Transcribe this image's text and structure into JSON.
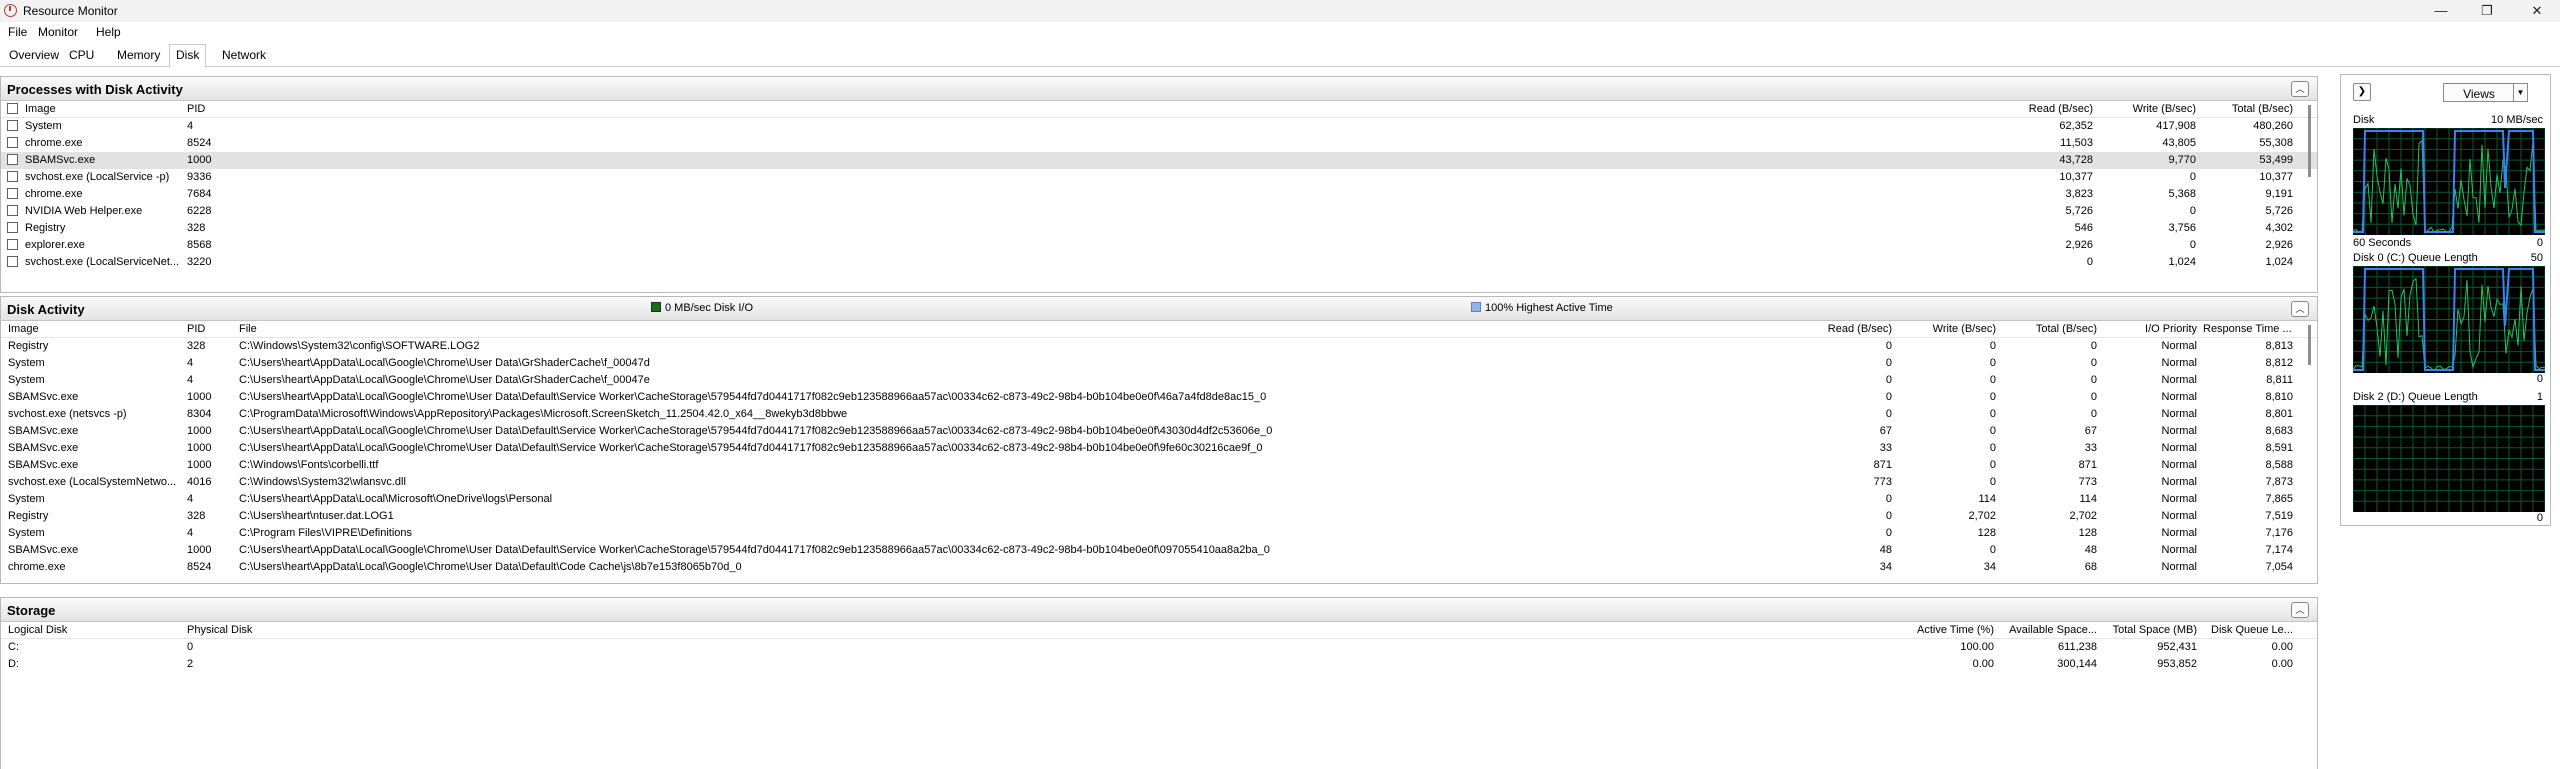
{
  "window": {
    "title": "Resource Monitor",
    "minimize": "—",
    "maximize": "❐",
    "close": "✕"
  },
  "menu": [
    "File",
    "Monitor",
    "Help"
  ],
  "tabs": [
    "Overview",
    "CPU",
    "Memory",
    "Disk",
    "Network"
  ],
  "active_tab": "Disk",
  "processes": {
    "title": "Processes with Disk Activity",
    "headers": {
      "image": "Image",
      "pid": "PID",
      "read": "Read (B/sec)",
      "write": "Write (B/sec)",
      "total": "Total (B/sec)"
    },
    "rows": [
      {
        "image": "System",
        "pid": "4",
        "read": "62,352",
        "write": "417,908",
        "total": "480,260"
      },
      {
        "image": "chrome.exe",
        "pid": "8524",
        "read": "11,503",
        "write": "43,805",
        "total": "55,308"
      },
      {
        "image": "SBAMSvc.exe",
        "pid": "1000",
        "read": "43,728",
        "write": "9,770",
        "total": "53,499"
      },
      {
        "image": "svchost.exe (LocalService -p)",
        "pid": "9336",
        "read": "10,377",
        "write": "0",
        "total": "10,377"
      },
      {
        "image": "chrome.exe",
        "pid": "7684",
        "read": "3,823",
        "write": "5,368",
        "total": "9,191"
      },
      {
        "image": "NVIDIA Web Helper.exe",
        "pid": "6228",
        "read": "5,726",
        "write": "0",
        "total": "5,726"
      },
      {
        "image": "Registry",
        "pid": "328",
        "read": "546",
        "write": "3,756",
        "total": "4,302"
      },
      {
        "image": "explorer.exe",
        "pid": "8568",
        "read": "2,926",
        "write": "0",
        "total": "2,926"
      },
      {
        "image": "svchost.exe (LocalServiceNet...",
        "pid": "3220",
        "read": "0",
        "write": "1,024",
        "total": "1,024"
      }
    ]
  },
  "disk_activity": {
    "title": "Disk Activity",
    "legend_io": "0 MB/sec Disk I/O",
    "legend_active": "100% Highest Active Time",
    "io_color": "#1e6b1e",
    "active_color": "#8fb4e3",
    "headers": {
      "image": "Image",
      "pid": "PID",
      "file": "File",
      "read": "Read (B/sec)",
      "write": "Write (B/sec)",
      "total": "Total (B/sec)",
      "priority": "I/O Priority",
      "response": "Response Time ..."
    },
    "rows": [
      {
        "image": "Registry",
        "pid": "328",
        "file": "C:\\Windows\\System32\\config\\SOFTWARE.LOG2",
        "read": "0",
        "write": "0",
        "total": "0",
        "priority": "Normal",
        "response": "8,813"
      },
      {
        "image": "System",
        "pid": "4",
        "file": "C:\\Users\\heart\\AppData\\Local\\Google\\Chrome\\User Data\\GrShaderCache\\f_00047d",
        "read": "0",
        "write": "0",
        "total": "0",
        "priority": "Normal",
        "response": "8,812"
      },
      {
        "image": "System",
        "pid": "4",
        "file": "C:\\Users\\heart\\AppData\\Local\\Google\\Chrome\\User Data\\GrShaderCache\\f_00047e",
        "read": "0",
        "write": "0",
        "total": "0",
        "priority": "Normal",
        "response": "8,811"
      },
      {
        "image": "SBAMSvc.exe",
        "pid": "1000",
        "file": "C:\\Users\\heart\\AppData\\Local\\Google\\Chrome\\User Data\\Default\\Service Worker\\CacheStorage\\579544fd7d0441717f082c9eb123588966aa57ac\\00334c62-c873-49c2-98b4-b0b104be0e0f\\46a7a4fd8de8ac15_0",
        "read": "0",
        "write": "0",
        "total": "0",
        "priority": "Normal",
        "response": "8,810"
      },
      {
        "image": "svchost.exe (netsvcs -p)",
        "pid": "8304",
        "file": "C:\\ProgramData\\Microsoft\\Windows\\AppRepository\\Packages\\Microsoft.ScreenSketch_11.2504.42.0_x64__8wekyb3d8bbwe",
        "read": "0",
        "write": "0",
        "total": "0",
        "priority": "Normal",
        "response": "8,801"
      },
      {
        "image": "SBAMSvc.exe",
        "pid": "1000",
        "file": "C:\\Users\\heart\\AppData\\Local\\Google\\Chrome\\User Data\\Default\\Service Worker\\CacheStorage\\579544fd7d0441717f082c9eb123588966aa57ac\\00334c62-c873-49c2-98b4-b0b104be0e0f\\43030d4df2c53606e_0",
        "read": "67",
        "write": "0",
        "total": "67",
        "priority": "Normal",
        "response": "8,683"
      },
      {
        "image": "SBAMSvc.exe",
        "pid": "1000",
        "file": "C:\\Users\\heart\\AppData\\Local\\Google\\Chrome\\User Data\\Default\\Service Worker\\CacheStorage\\579544fd7d0441717f082c9eb123588966aa57ac\\00334c62-c873-49c2-98b4-b0b104be0e0f\\9fe60c30216cae9f_0",
        "read": "33",
        "write": "0",
        "total": "33",
        "priority": "Normal",
        "response": "8,591"
      },
      {
        "image": "SBAMSvc.exe",
        "pid": "1000",
        "file": "C:\\Windows\\Fonts\\corbelli.ttf",
        "read": "871",
        "write": "0",
        "total": "871",
        "priority": "Normal",
        "response": "8,588"
      },
      {
        "image": "svchost.exe (LocalSystemNetwo...",
        "pid": "4016",
        "file": "C:\\Windows\\System32\\wlansvc.dll",
        "read": "773",
        "write": "0",
        "total": "773",
        "priority": "Normal",
        "response": "7,873"
      },
      {
        "image": "System",
        "pid": "4",
        "file": "C:\\Users\\heart\\AppData\\Local\\Microsoft\\OneDrive\\logs\\Personal",
        "read": "0",
        "write": "114",
        "total": "114",
        "priority": "Normal",
        "response": "7,865"
      },
      {
        "image": "Registry",
        "pid": "328",
        "file": "C:\\Users\\heart\\ntuser.dat.LOG1",
        "read": "0",
        "write": "2,702",
        "total": "2,702",
        "priority": "Normal",
        "response": "7,519"
      },
      {
        "image": "System",
        "pid": "4",
        "file": "C:\\Program Files\\VIPRE\\Definitions",
        "read": "0",
        "write": "128",
        "total": "128",
        "priority": "Normal",
        "response": "7,176"
      },
      {
        "image": "SBAMSvc.exe",
        "pid": "1000",
        "file": "C:\\Users\\heart\\AppData\\Local\\Google\\Chrome\\User Data\\Default\\Service Worker\\CacheStorage\\579544fd7d0441717f082c9eb123588966aa57ac\\00334c62-c873-49c2-98b4-b0b104be0e0f\\097055410aa8a2ba_0",
        "read": "48",
        "write": "0",
        "total": "48",
        "priority": "Normal",
        "response": "7,174"
      },
      {
        "image": "chrome.exe",
        "pid": "8524",
        "file": "C:\\Users\\heart\\AppData\\Local\\Google\\Chrome\\User Data\\Default\\Code Cache\\js\\8b7e153f8065b70d_0",
        "read": "34",
        "write": "34",
        "total": "68",
        "priority": "Normal",
        "response": "7,054"
      }
    ]
  },
  "storage": {
    "title": "Storage",
    "headers": {
      "logical": "Logical Disk",
      "physical": "Physical Disk",
      "active": "Active Time (%)",
      "available": "Available Space...",
      "total": "Total Space (MB)",
      "queue": "Disk Queue Le..."
    },
    "rows": [
      {
        "logical": "C:",
        "physical": "0",
        "active": "100.00",
        "available": "611,238",
        "total": "952,431",
        "queue": "0.00"
      },
      {
        "logical": "D:",
        "physical": "2",
        "active": "0.00",
        "available": "300,144",
        "total": "953,852",
        "queue": "0.00"
      }
    ]
  },
  "side": {
    "views_label": "Views",
    "expand_icon": "chevron-right-icon",
    "graphs": [
      {
        "label": "Disk",
        "scale": "10 MB/sec",
        "bottom_left": "60 Seconds",
        "bottom_right": "0",
        "line_color": "#22c55e",
        "active_color": "#3b82f6"
      },
      {
        "label": "Disk 0 (C:) Queue Length",
        "scale": "50",
        "bottom_left": "",
        "bottom_right": "0",
        "line_color": "#22c55e",
        "active_color": "#3b82f6"
      },
      {
        "label": "Disk 2 (D:) Queue Length",
        "scale": "1",
        "bottom_left": "",
        "bottom_right": "0",
        "line_color": "#22c55e",
        "active_color": "#3b82f6"
      }
    ]
  }
}
